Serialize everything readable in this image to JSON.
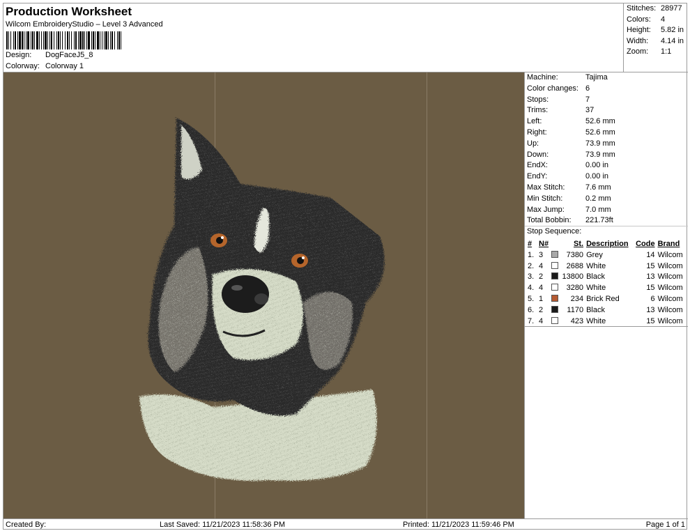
{
  "header": {
    "title": "Production Worksheet",
    "subtitle": "Wilcom EmbroideryStudio – Level 3 Advanced",
    "design_label": "Design:",
    "design_value": "DogFaceJ5_8",
    "colorway_label": "Colorway:",
    "colorway_value": "Colorway 1"
  },
  "summary": [
    {
      "label": "Stitches:",
      "value": "28977"
    },
    {
      "label": "Colors:",
      "value": "4"
    },
    {
      "label": "Height:",
      "value": "5.82 in"
    },
    {
      "label": "Width:",
      "value": "4.14 in"
    },
    {
      "label": "Zoom:",
      "value": "1:1"
    }
  ],
  "machine_info": [
    {
      "label": "Machine:",
      "value": "Tajima"
    },
    {
      "label": "Color changes:",
      "value": "6"
    },
    {
      "label": "Stops:",
      "value": "7"
    },
    {
      "label": "Trims:",
      "value": "37"
    },
    {
      "label": "Left:",
      "value": "52.6 mm"
    },
    {
      "label": "Right:",
      "value": "52.6 mm"
    },
    {
      "label": "Up:",
      "value": "73.9 mm"
    },
    {
      "label": "Down:",
      "value": "73.9 mm"
    },
    {
      "label": "EndX:",
      "value": "0.00 in"
    },
    {
      "label": "EndY:",
      "value": "0.00 in"
    },
    {
      "label": "Max Stitch:",
      "value": "7.6 mm"
    },
    {
      "label": "Min Stitch:",
      "value": "0.2 mm"
    },
    {
      "label": "Max Jump:",
      "value": "7.0 mm"
    },
    {
      "label": "Total Bobbin:",
      "value": "221.73ft"
    }
  ],
  "stop_sequence": {
    "label": "Stop Sequence:",
    "columns": [
      "#",
      "N#",
      "St.",
      "Description",
      "Code",
      "Brand"
    ],
    "rows": [
      {
        "idx": "1.",
        "n": "3",
        "color": "#a8a8a8",
        "st": "7380",
        "desc": "Grey",
        "code": "14",
        "brand": "Wilcom"
      },
      {
        "idx": "2.",
        "n": "4",
        "color": "#ffffff",
        "st": "2688",
        "desc": "White",
        "code": "15",
        "brand": "Wilcom"
      },
      {
        "idx": "3.",
        "n": "2",
        "color": "#1a1a1a",
        "st": "13800",
        "desc": "Black",
        "code": "13",
        "brand": "Wilcom"
      },
      {
        "idx": "4.",
        "n": "4",
        "color": "#ffffff",
        "st": "3280",
        "desc": "White",
        "code": "15",
        "brand": "Wilcom"
      },
      {
        "idx": "5.",
        "n": "1",
        "color": "#b55a32",
        "st": "234",
        "desc": "Brick Red",
        "code": "6",
        "brand": "Wilcom"
      },
      {
        "idx": "6.",
        "n": "2",
        "color": "#1a1a1a",
        "st": "1170",
        "desc": "Black",
        "code": "13",
        "brand": "Wilcom"
      },
      {
        "idx": "7.",
        "n": "4",
        "color": "#ffffff",
        "st": "423",
        "desc": "White",
        "code": "15",
        "brand": "Wilcom"
      }
    ]
  },
  "footer": {
    "created_by": "Created By:",
    "last_saved": "Last Saved: 11/21/2023 11:58:36 PM",
    "printed": "Printed: 11/21/2023 11:59:46 PM",
    "page": "Page 1 of 1"
  },
  "design": {
    "background_color": "#6b5c44",
    "artwork": "embroidered-dog-face"
  }
}
